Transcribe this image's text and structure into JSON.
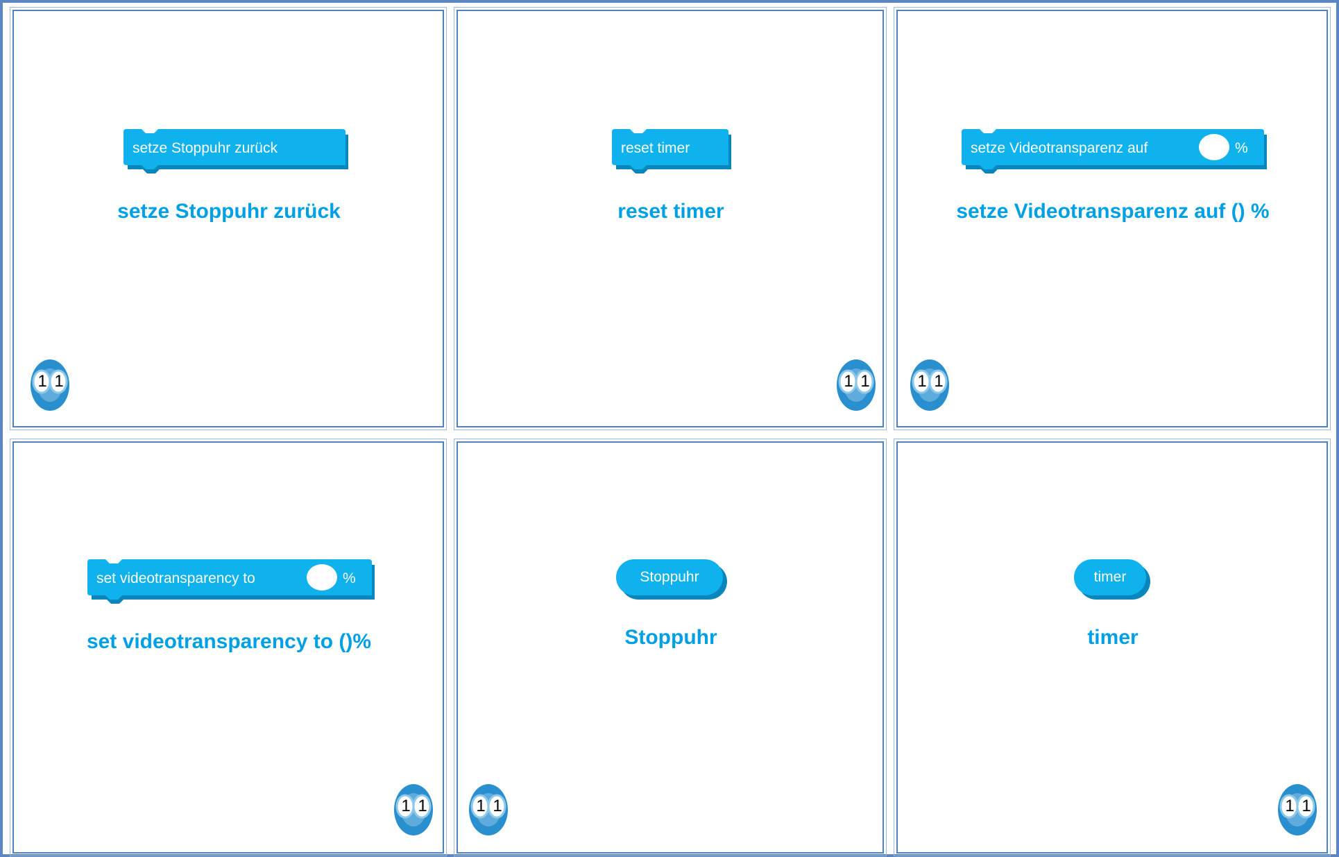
{
  "colors": {
    "block": "#0fb2ec",
    "block_shadow": "#0a86bd",
    "caption": "#00a0e6",
    "grid_line": "#4f81bd",
    "badge": "#2a8fcf"
  },
  "cells": [
    {
      "block_label": "setze Stoppuhr zurück",
      "block_suffix": "",
      "block_shape": "stack",
      "caption": "setze Stoppuhr zurück",
      "badge_digits": [
        "1",
        "1"
      ],
      "badge_icon": "scratch-extension-icon"
    },
    {
      "block_label": "reset timer",
      "block_suffix": "",
      "block_shape": "stack",
      "caption": "reset timer",
      "badge_digits": [
        "1",
        "1"
      ],
      "badge_icon": "scratch-extension-icon"
    },
    {
      "block_label": "setze Videotransparenz auf",
      "block_suffix": "%",
      "block_shape": "stack-input",
      "caption": "setze Videotransparenz auf () %",
      "badge_digits": [
        "1",
        "1"
      ],
      "badge_icon": "scratch-extension-icon"
    },
    {
      "block_label": "set videotransparency to",
      "block_suffix": "%",
      "block_shape": "stack-input",
      "caption": "set videotransparency to ()%",
      "badge_digits": [
        "1",
        "1"
      ],
      "badge_icon": "scratch-extension-icon"
    },
    {
      "block_label": "Stoppuhr",
      "block_suffix": "",
      "block_shape": "reporter",
      "caption": "Stoppuhr",
      "badge_digits": [
        "1",
        "1"
      ],
      "badge_icon": "scratch-extension-icon"
    },
    {
      "block_label": "timer",
      "block_suffix": "",
      "block_shape": "reporter",
      "caption": "timer",
      "badge_digits": [
        "1",
        "1"
      ],
      "badge_icon": "scratch-extension-icon"
    }
  ]
}
